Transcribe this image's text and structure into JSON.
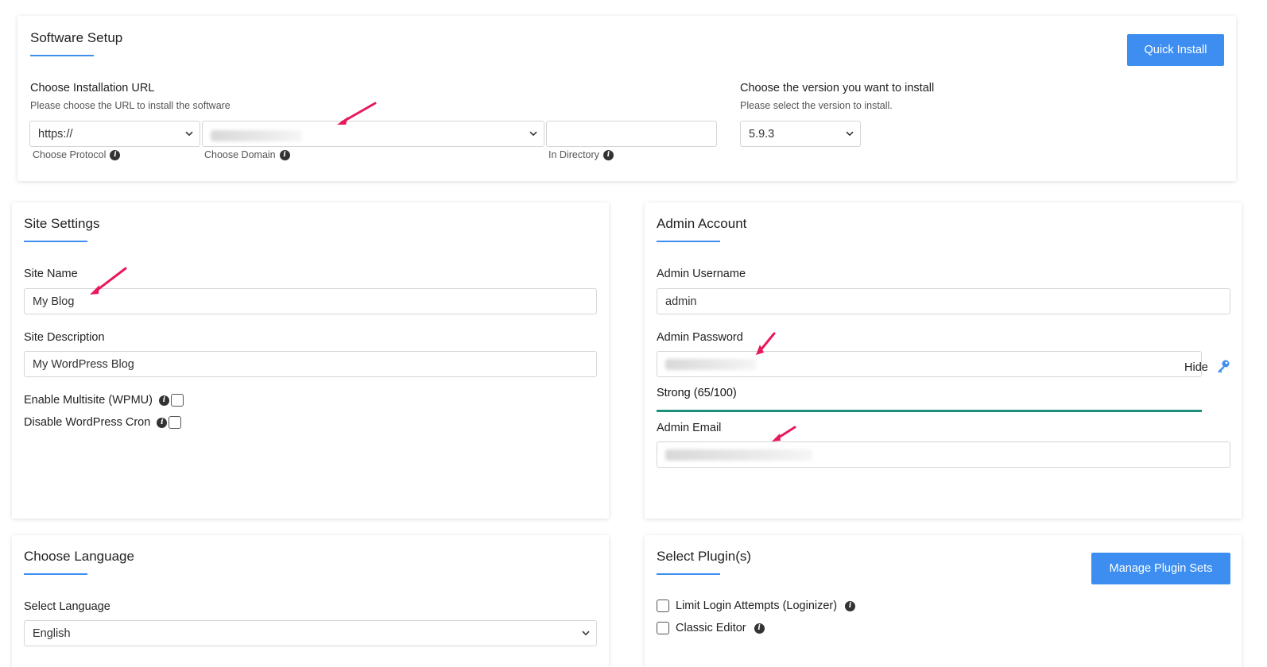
{
  "software_setup": {
    "title": "Software Setup",
    "quick_install_label": "Quick Install",
    "install_url": {
      "label": "Choose Installation URL",
      "sublabel": "Please choose the URL to install the software",
      "protocol_value": "https://",
      "protocol_hint": "Choose Protocol",
      "domain_hint": "Choose Domain",
      "directory_value": "",
      "directory_hint": "In Directory"
    },
    "version": {
      "label": "Choose the version you want to install",
      "sublabel": "Please select the version to install.",
      "value": "5.9.3"
    }
  },
  "site_settings": {
    "title": "Site Settings",
    "site_name_label": "Site Name",
    "site_name_value": "My Blog",
    "site_description_label": "Site Description",
    "site_description_value": "My WordPress Blog",
    "multisite_label": "Enable Multisite (WPMU)",
    "cron_label": "Disable WordPress Cron"
  },
  "admin_account": {
    "title": "Admin Account",
    "username_label": "Admin Username",
    "username_value": "admin",
    "password_label": "Admin Password",
    "hide_label": "Hide",
    "strength_label": "Strong (65/100)",
    "strength_value": 65,
    "email_label": "Admin Email"
  },
  "choose_language": {
    "title": "Choose Language",
    "select_label": "Select Language",
    "value": "English"
  },
  "plugins": {
    "title": "Select Plugin(s)",
    "manage_label": "Manage Plugin Sets",
    "items": [
      {
        "label": "Limit Login Attempts (Loginizer)"
      },
      {
        "label": "Classic Editor"
      }
    ]
  },
  "colors": {
    "accent": "#3d8ef0",
    "strength": "#1a8f7a",
    "arrow": "#e8195a"
  }
}
